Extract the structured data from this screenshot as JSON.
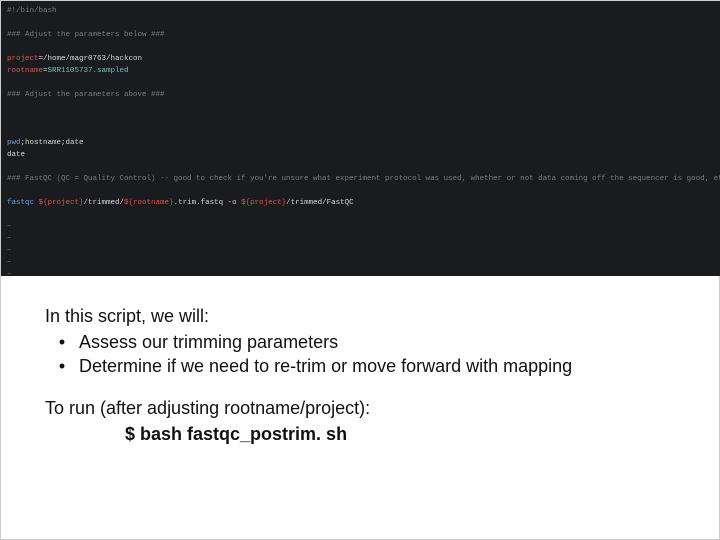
{
  "terminal": {
    "lines": [
      {
        "segments": [
          {
            "cls": "gray",
            "text": "#!/bin/bash"
          }
        ]
      },
      {
        "segments": []
      },
      {
        "segments": [
          {
            "cls": "gray",
            "text": "### Adjust the parameters below ###"
          }
        ]
      },
      {
        "segments": []
      },
      {
        "segments": [
          {
            "cls": "red",
            "text": "project"
          },
          {
            "cls": "ltext",
            "text": "=/home/magr0763/hackcon"
          }
        ]
      },
      {
        "segments": [
          {
            "cls": "red",
            "text": "rootname"
          },
          {
            "cls": "ltext",
            "text": "="
          },
          {
            "cls": "teal",
            "text": "SRR1105737.sampled"
          }
        ]
      },
      {
        "segments": []
      },
      {
        "segments": [
          {
            "cls": "gray",
            "text": "### Adjust the parameters above ###"
          }
        ]
      },
      {
        "segments": []
      },
      {
        "segments": []
      },
      {
        "segments": []
      },
      {
        "segments": [
          {
            "cls": "blue",
            "text": "pwd"
          },
          {
            "cls": "ltext",
            "text": ";hostname;date"
          }
        ]
      },
      {
        "segments": [
          {
            "cls": "ltext",
            "text": "date"
          }
        ]
      },
      {
        "segments": []
      },
      {
        "segments": [
          {
            "cls": "gray",
            "text": "### FastQC (QC = Quality Control) -- good to check if you're unsure what experiment protocol was used, whether or not data coming off the sequencer is good, etc."
          }
        ]
      },
      {
        "segments": []
      },
      {
        "segments": [
          {
            "cls": "blue",
            "text": "fastqc "
          },
          {
            "cls": "red",
            "text": "${project}"
          },
          {
            "cls": "ltext",
            "text": "/trimmed/"
          },
          {
            "cls": "red",
            "text": "${rootname}"
          },
          {
            "cls": "ltext",
            "text": ".trim.fastq "
          },
          {
            "cls": "yellow",
            "text": "-o "
          },
          {
            "cls": "red",
            "text": "${project}"
          },
          {
            "cls": "ltext",
            "text": "/trimmed/FastQC"
          }
        ]
      },
      {
        "segments": []
      },
      {
        "segments": [
          {
            "cls": "gray",
            "text": "~"
          }
        ]
      },
      {
        "segments": [
          {
            "cls": "gray",
            "text": "~"
          }
        ]
      },
      {
        "segments": [
          {
            "cls": "gray",
            "text": "~"
          }
        ]
      },
      {
        "segments": [
          {
            "cls": "gray",
            "text": "~"
          }
        ]
      },
      {
        "segments": [
          {
            "cls": "gray",
            "text": "~"
          }
        ]
      },
      {
        "segments": [
          {
            "cls": "gray",
            "text": "~"
          }
        ]
      },
      {
        "segments": [
          {
            "cls": "gray",
            "text": "~"
          }
        ]
      }
    ]
  },
  "doc": {
    "intro": "In this script, we will:",
    "bullet1": "Assess our trimming parameters",
    "bullet2": "Determine if we need to re-trim or move forward with mapping",
    "runline": "To run (after adjusting rootname/project):",
    "cmd": "$ bash fastqc_postrim. sh"
  }
}
